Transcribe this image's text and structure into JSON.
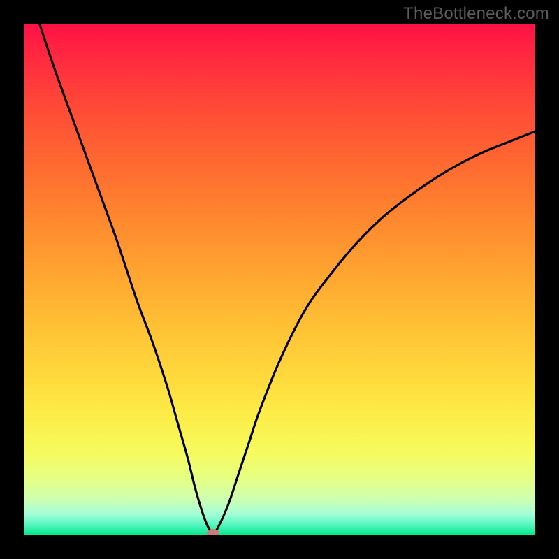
{
  "watermark": "TheBottleneck.com",
  "chart_data": {
    "type": "line",
    "title": "",
    "xlabel": "",
    "ylabel": "",
    "xlim": [
      0,
      100
    ],
    "ylim": [
      0,
      100
    ],
    "grid": false,
    "series": [
      {
        "name": "curve",
        "x": [
          3,
          6,
          10,
          14,
          18,
          22,
          25,
          28,
          30,
          32,
          33.5,
          35,
          36,
          37,
          38,
          40,
          42,
          44,
          46,
          50,
          55,
          60,
          65,
          70,
          75,
          80,
          85,
          90,
          95,
          100
        ],
        "y": [
          100,
          91,
          80,
          69,
          58,
          46,
          38,
          29,
          22,
          15,
          9,
          4,
          1.5,
          0.3,
          1.5,
          6,
          12,
          18,
          24,
          34,
          44,
          51,
          57,
          62,
          66,
          69.5,
          72.5,
          75,
          77,
          79
        ]
      }
    ],
    "marker": {
      "x": 37,
      "y": 0.3,
      "color": "#cc7b78"
    },
    "background_gradient_meaning": "red_top_to_green_bottom"
  }
}
